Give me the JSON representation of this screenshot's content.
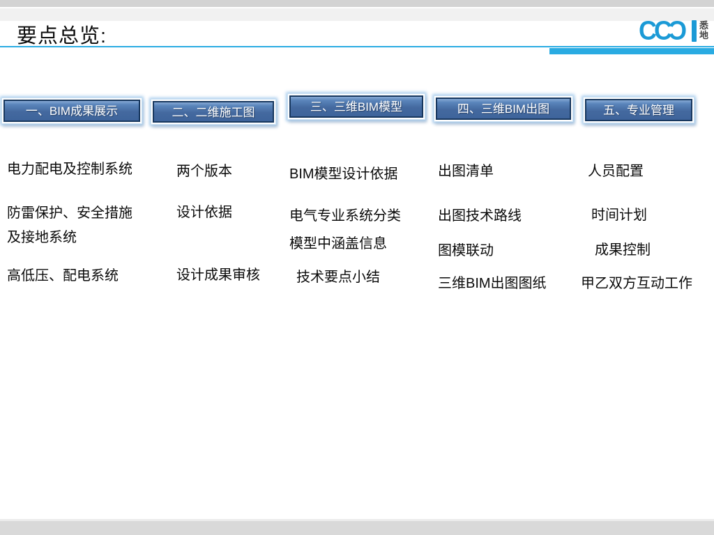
{
  "page": {
    "title": "要点总览:"
  },
  "logo": {
    "letter1": "C",
    "letter2": "C",
    "letter3": "C",
    "cn_top": "悉",
    "cn_bottom": "地",
    "color": "#1b9ad6"
  },
  "colors": {
    "accent_blue": "#29abe2",
    "tab_fill": "#44699f",
    "tab_border": "#17375e",
    "chrome_gray": "#d3d3d3"
  },
  "tabs": [
    {
      "label": "一、BIM成果展示"
    },
    {
      "label": "二、二维施工图"
    },
    {
      "label": "三、三维BIM模型"
    },
    {
      "label": "四、三维BIM出图"
    },
    {
      "label": "五、专业管理"
    }
  ],
  "columns": [
    {
      "items": [
        "电力配电及控制系统",
        "防雷保护、安全措施\n及接地系统",
        "高低压、配电系统"
      ]
    },
    {
      "items": [
        "两个版本",
        "设计依据",
        "设计成果审核"
      ]
    },
    {
      "items": [
        "BIM模型设计依据",
        "电气专业系统分类",
        "模型中涵盖信息",
        "技术要点小结"
      ]
    },
    {
      "items": [
        "出图清单",
        "出图技术路线",
        "图模联动",
        "三维BIM出图图纸"
      ]
    },
    {
      "items": [
        "人员配置",
        "时间计划",
        "成果控制",
        "甲乙双方互动工作"
      ]
    }
  ]
}
